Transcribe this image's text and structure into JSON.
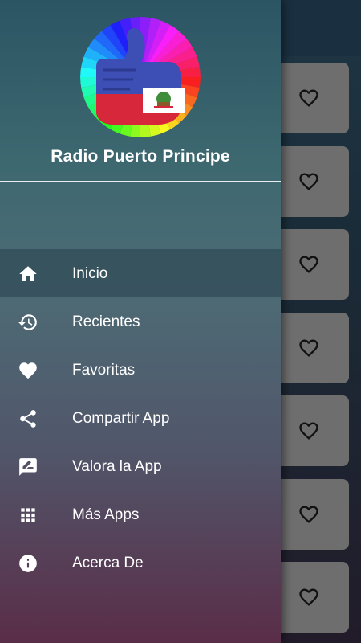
{
  "drawer": {
    "title": "Radio Puerto Principe",
    "items": [
      {
        "label": "Inicio",
        "icon": "home-icon",
        "active": true
      },
      {
        "label": "Recientes",
        "icon": "history-icon",
        "active": false
      },
      {
        "label": "Favoritas",
        "icon": "heart-icon",
        "active": false
      },
      {
        "label": "Compartir App",
        "icon": "share-icon",
        "active": false
      },
      {
        "label": "Valora la App",
        "icon": "rate-review-icon",
        "active": false
      },
      {
        "label": "Más Apps",
        "icon": "apps-grid-icon",
        "active": false
      },
      {
        "label": "Acerca De",
        "icon": "info-icon",
        "active": false
      }
    ]
  },
  "background_list": {
    "card_icon": "heart-outline-icon",
    "card_count": 7
  },
  "colors": {
    "drawer_top": "#2b5563",
    "drawer_bottom": "#5a2d48",
    "card": "#6e6e6e",
    "text": "#ffffff"
  }
}
